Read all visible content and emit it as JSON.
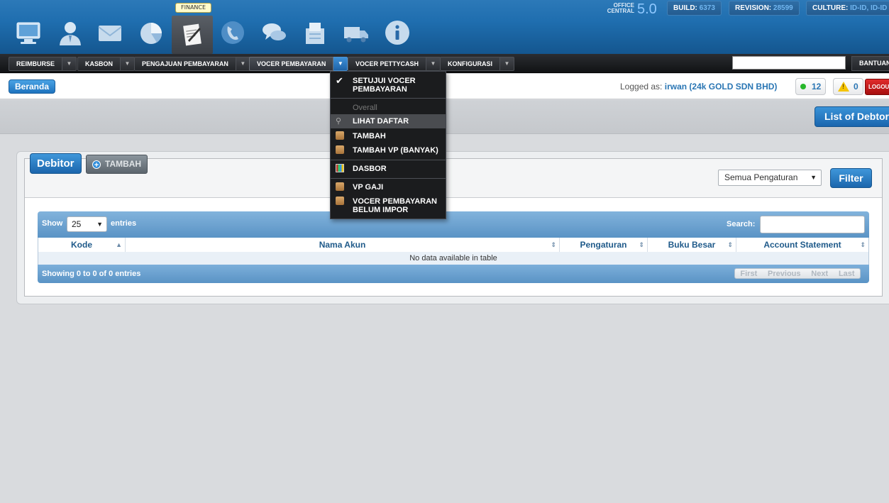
{
  "header": {
    "active_module_tooltip": "FINANCE",
    "icons": [
      "monitor-icon",
      "user-icon",
      "mail-icon",
      "pie-chart-icon",
      "finance-icon",
      "phone-icon",
      "chat-icon",
      "inventory-icon",
      "truck-icon",
      "info-icon"
    ],
    "brand_small": "OFFICE\nCENTRAL",
    "brand_version": "5.0",
    "build_label": "BUILD:",
    "build_value": "6373",
    "revision_label": "REVISION:",
    "revision_value": "28599",
    "culture_label": "CULTURE:",
    "culture_value": "ID-ID, ID-ID"
  },
  "nav": {
    "items": [
      {
        "label": "REIMBURSE"
      },
      {
        "label": "KASBON"
      },
      {
        "label": "PENGAJUAN PEMBAYARAN"
      },
      {
        "label": "VOCER PEMBAYARAN"
      },
      {
        "label": "VOCER PETTYCASH"
      },
      {
        "label": "KONFIGURASI"
      }
    ],
    "search_value": "",
    "help_label": "BANTUAN"
  },
  "subbar": {
    "home_label": "Beranda",
    "logged_prefix": "Logged as:",
    "logged_user": "irwan (24k GOLD SDN BHD)",
    "online_count": "12",
    "warning_count": "0",
    "logout_label": "LOGOUT"
  },
  "band": {
    "list_button": "List of Debtors"
  },
  "panel": {
    "tab_label": "Debitor",
    "add_label": "TAMBAH",
    "filter_select": "Semua Pengaturan",
    "filter_button": "Filter"
  },
  "table": {
    "show_label": "Show",
    "page_length": "25",
    "entries_label": "entries",
    "search_label": "Search:",
    "columns": [
      "Kode",
      "Nama Akun",
      "Pengaturan",
      "Buku Besar",
      "Account Statement"
    ],
    "empty_text": "No data available in table",
    "info_text": "Showing 0 to 0 of 0 entries",
    "pager": [
      "First",
      "Previous",
      "Next",
      "Last"
    ]
  },
  "menu": {
    "approve": "SETUJUI VOCER\nPEMBAYARAN",
    "section": "Overall",
    "view_list": "LIHAT DAFTAR",
    "add": "TAMBAH",
    "add_bulk": "TAMBAH VP (BANYAK)",
    "dashboard": "DASBOR",
    "vp_salary": "VP GAJI",
    "unimported": "VOCER PEMBAYARAN\nBELUM IMPOR"
  }
}
